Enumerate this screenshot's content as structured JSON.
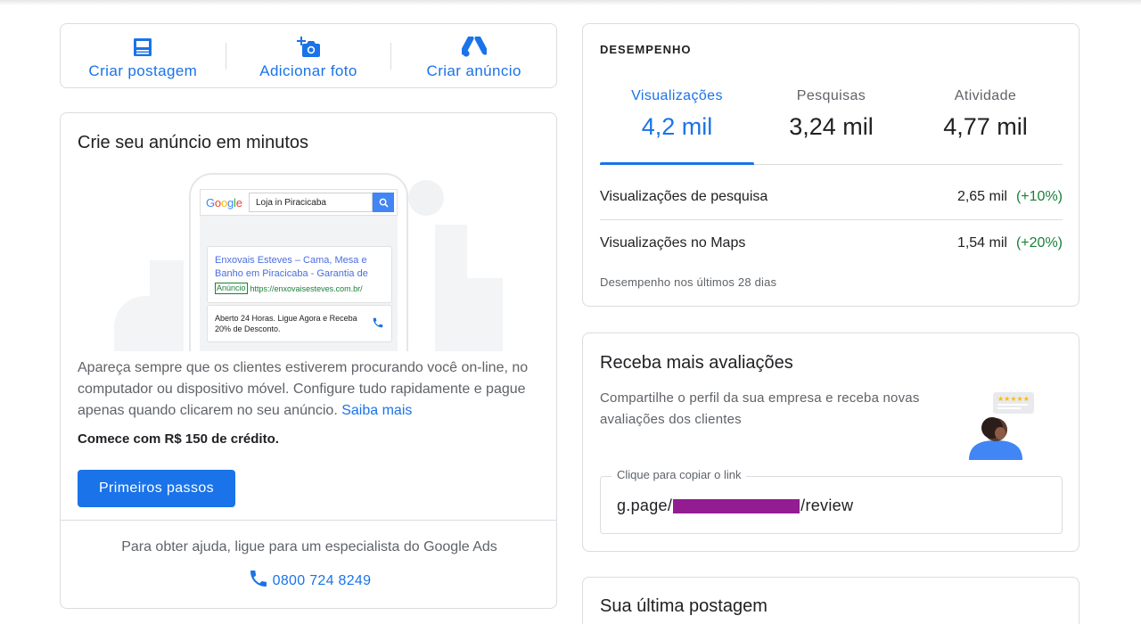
{
  "actions": [
    {
      "label": "Criar postagem",
      "icon": "post-icon"
    },
    {
      "label": "Adicionar foto",
      "icon": "add-photo-icon"
    },
    {
      "label": "Criar anúncio",
      "icon": "google-ads-icon"
    }
  ],
  "ads_card": {
    "title": "Crie seu anúncio em minutos",
    "mock": {
      "google_logo": "Google",
      "search_query": "Loja in Piracicaba",
      "result_title": "Enxovais Esteves – Cama, Mesa e Banho em Piracicaba - Garantia de",
      "ad_badge": "Anúncio",
      "result_url": "https://enxovaisesteves.com.br/",
      "result2_text": "Aberto 24 Horas. Ligue Agora e Receba 20% de Desconto."
    },
    "description": "Apareça sempre que os clientes estiverem procurando você on-line, no computador ou dispositivo móvel. Configure tudo rapidamente e pague apenas quando clicarem no seu anúncio.",
    "learn_more": "Saiba mais",
    "credit": "Comece com R$ 150 de crédito.",
    "button": "Primeiros passos",
    "help_text": "Para obter ajuda, ligue para um especialista do Google Ads",
    "phone": "0800 724 8249"
  },
  "performance": {
    "title": "DESEMPENHO",
    "tabs": [
      {
        "label": "Visualizações",
        "value": "4,2 mil",
        "active": true
      },
      {
        "label": "Pesquisas",
        "value": "3,24 mil",
        "active": false
      },
      {
        "label": "Atividade",
        "value": "4,77 mil",
        "active": false
      }
    ],
    "rows": [
      {
        "label": "Visualizações de pesquisa",
        "value": "2,65 mil",
        "delta": "(+10%)"
      },
      {
        "label": "Visualizações no Maps",
        "value": "1,54 mil",
        "delta": "(+20%)"
      }
    ],
    "footer": "Desempenho nos últimos 28 dias"
  },
  "reviews": {
    "title": "Receba mais avaliações",
    "description": "Compartilhe o perfil da sua empresa e receba novas avaliações dos clientes",
    "link_legend": "Clique para copiar o link",
    "link_prefix": "g.page/",
    "link_suffix": "/review"
  },
  "last_post": {
    "title": "Sua última postagem"
  },
  "colors": {
    "accent": "#1a73e8",
    "positive": "#188038",
    "redaction": "#931c93"
  }
}
